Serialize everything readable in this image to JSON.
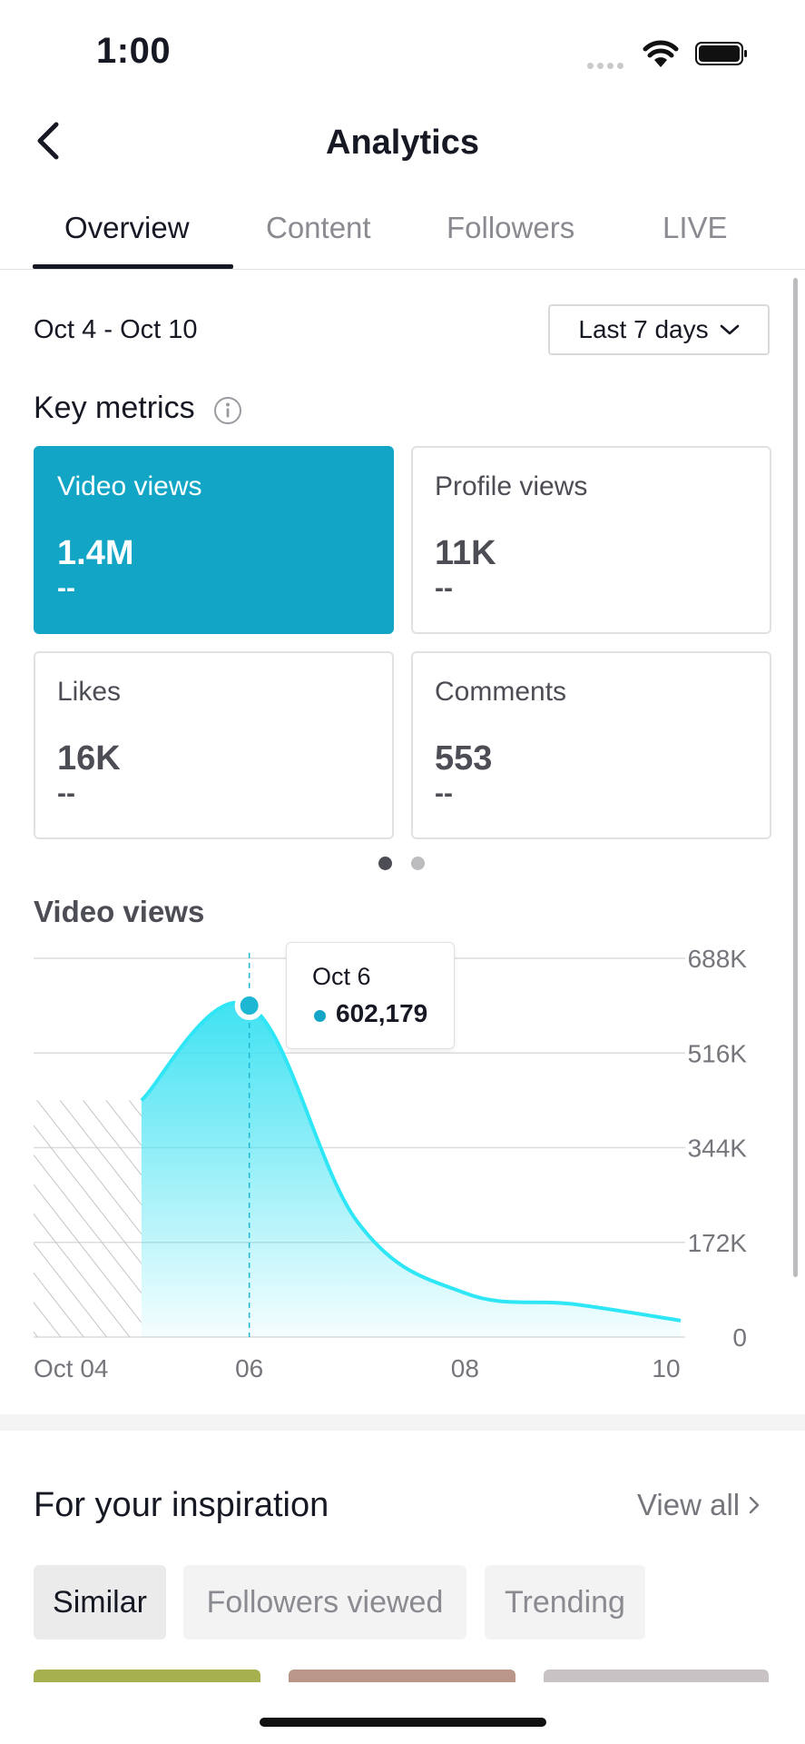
{
  "status_bar": {
    "time": "1:00"
  },
  "header": {
    "title": "Analytics"
  },
  "tabs": [
    {
      "label": "Overview",
      "active": true
    },
    {
      "label": "Content",
      "active": false
    },
    {
      "label": "Followers",
      "active": false
    },
    {
      "label": "LIVE",
      "active": false
    }
  ],
  "filter": {
    "date_range": "Oct 4 - Oct 10",
    "period": "Last 7 days"
  },
  "key_metrics": {
    "title": "Key metrics",
    "cards": [
      {
        "label": "Video views",
        "value": "1.4M",
        "change": "--",
        "active": true
      },
      {
        "label": "Profile views",
        "value": "11K",
        "change": "--",
        "active": false
      },
      {
        "label": "Likes",
        "value": "16K",
        "change": "--",
        "active": false
      },
      {
        "label": "Comments",
        "value": "553",
        "change": "--",
        "active": false
      }
    ],
    "page_indicator": {
      "current": 1,
      "total": 2
    }
  },
  "chart_section": {
    "title": "Video views"
  },
  "chart_data": {
    "type": "area",
    "title": "Video views",
    "x": [
      "Oct 4",
      "Oct 5",
      "Oct 6",
      "Oct 7",
      "Oct 8",
      "Oct 9",
      "Oct 10"
    ],
    "x_tick_labels": [
      "Oct 04",
      "06",
      "08",
      "10"
    ],
    "series": [
      {
        "values": [
          null,
          430000,
          602179,
          210000,
          80000,
          60000,
          30000
        ]
      }
    ],
    "y_ticks": [
      0,
      172000,
      344000,
      516000,
      688000
    ],
    "y_tick_labels": [
      "0",
      "172K",
      "344K",
      "516K",
      "688K"
    ],
    "ylim": [
      0,
      688000
    ],
    "y_axis_position": "right",
    "grid": true,
    "no_data_range": [
      "Oct 4",
      "Oct 5"
    ],
    "tooltip": {
      "date": "Oct 6",
      "value": "602,179"
    },
    "colors": {
      "line": "#2ee6f5",
      "fill": "#3fe2f2",
      "marker": "#1db7d4"
    }
  },
  "inspiration": {
    "title": "For your inspiration",
    "view_all": "View all",
    "chips": [
      {
        "label": "Similar",
        "active": true
      },
      {
        "label": "Followers viewed",
        "active": false
      },
      {
        "label": "Trending",
        "active": false
      }
    ]
  },
  "colors": {
    "accent": "#12a5c6",
    "text": "#161823",
    "muted": "#8a8b91"
  }
}
